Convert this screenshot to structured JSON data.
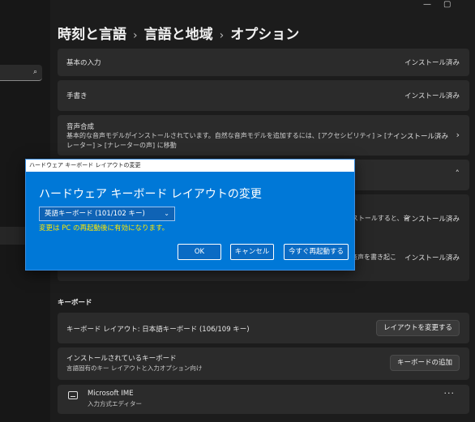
{
  "window": {
    "minimize_glyph": "—",
    "maximize_glyph": "▢"
  },
  "sidebar": {
    "search_icon": "⌕"
  },
  "breadcrumb": {
    "items": [
      "時刻と言語",
      "言語と地域",
      "オプション"
    ],
    "separator": "›"
  },
  "cards": [
    {
      "title": "基本の入力",
      "status": "インストール済み"
    },
    {
      "title": "手書き",
      "status": "インストール済み"
    },
    {
      "title": "音声合成",
      "description": "基本的な音声モデルがインストールされています。自然な音声モデルを追加するには、[アクセシビリティ] > [ナレーター] > [ナレーターの声] に移動",
      "status": "インストール済み",
      "chevron": "›"
    }
  ],
  "hidden_rows": [
    {
      "truncated": "ンストールすると、音",
      "status": "インストール済み"
    },
    {
      "truncated": "音声を書き起こ",
      "status": "インストール済み"
    }
  ],
  "collapse_chevron": "˄",
  "keyboard_section": {
    "label": "キーボード",
    "layout_row": {
      "title": "キーボード レイアウト: 日本語キーボード (106/109 キー)",
      "button": "レイアウトを変更する"
    },
    "installed_row": {
      "title": "インストールされているキーボード",
      "subtitle": "言語固有のキー レイアウトと入力オプション向け",
      "button": "キーボードの追加"
    },
    "ime": {
      "title": "Microsoft IME",
      "subtitle": "入力方式エディター",
      "more": "···"
    }
  },
  "dialog": {
    "window_title": "ハードウェア キーボード レイアウトの変更",
    "heading": "ハードウェア キーボード レイアウトの変更",
    "selected_layout": "英語キーボード (101/102 キー)",
    "caret": "⌄",
    "notice": "変更は PC の再起動後に有効になります。",
    "ok": "OK",
    "cancel": "キャンセル",
    "restart": "今すぐ再起動する"
  }
}
